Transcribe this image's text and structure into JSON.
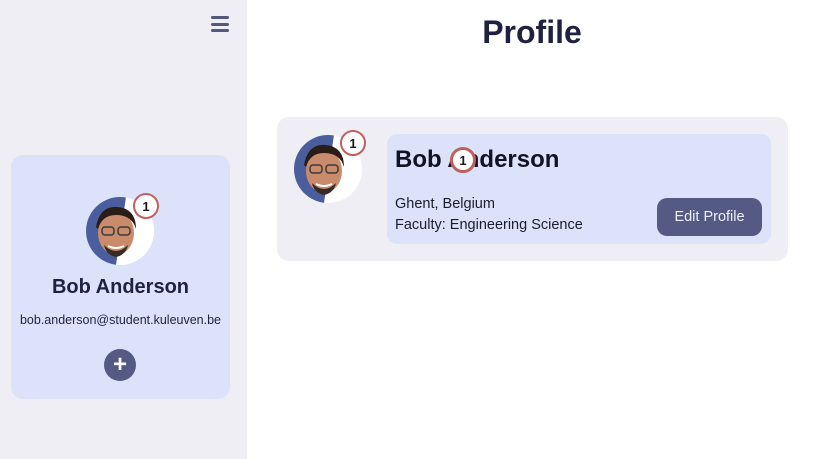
{
  "sidebar": {
    "menu_icon": "hamburger-menu-icon",
    "user": {
      "name": "Bob Anderson",
      "email": "bob.anderson@student.kuleuven.be",
      "notification_count": "1"
    },
    "add_icon": "plus-icon",
    "add_label": "+"
  },
  "main": {
    "title": "Profile",
    "profile": {
      "name": "Bob Anderson",
      "notification_count": "1",
      "location": "Ghent, Belgium",
      "faculty": "Faculty: Engineering Science",
      "edit_label": "Edit Profile"
    }
  },
  "colors": {
    "sidebar_bg": "#efeef4",
    "card_bg": "#dde2fb",
    "accent": "#545a84",
    "badge_border": "#c0605c"
  }
}
